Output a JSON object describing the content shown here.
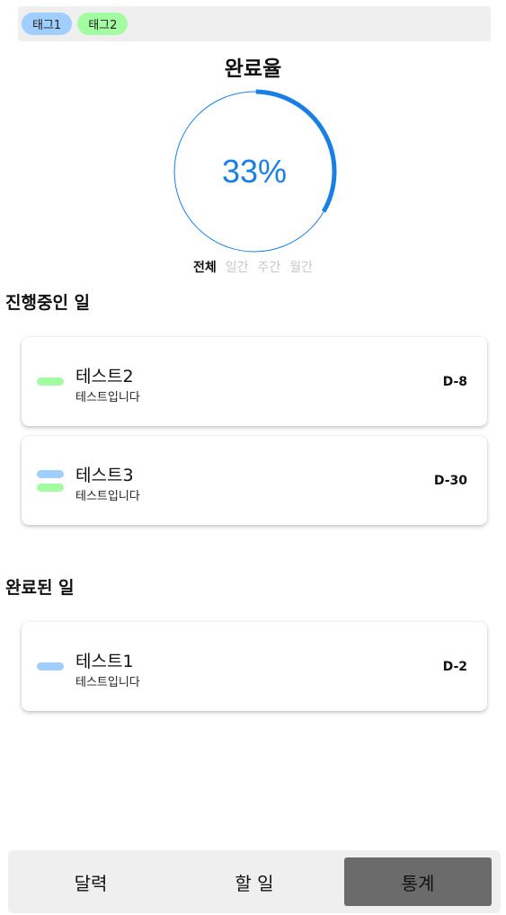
{
  "tags": [
    {
      "label": "태그1",
      "color": "#a0ceff"
    },
    {
      "label": "태그2",
      "color": "#a3fca0"
    }
  ],
  "completion": {
    "title": "완료율",
    "percent": 33,
    "percent_label": "33%",
    "arc_color": "#1a7fe5"
  },
  "periods": [
    {
      "label": "전체",
      "active": true
    },
    {
      "label": "일간",
      "active": false
    },
    {
      "label": "주간",
      "active": false
    },
    {
      "label": "월간",
      "active": false
    }
  ],
  "in_progress": {
    "title": "진행중인 일",
    "items": [
      {
        "title": "테스트2",
        "desc": "테스트입니다",
        "dday": "D-8",
        "tags": [
          "green"
        ]
      },
      {
        "title": "테스트3",
        "desc": "테스트입니다",
        "dday": "D-30",
        "tags": [
          "blue",
          "green"
        ]
      }
    ]
  },
  "completed": {
    "title": "완료된 일",
    "items": [
      {
        "title": "테스트1",
        "desc": "테스트입니다",
        "dday": "D-2",
        "tags": [
          "blue"
        ]
      }
    ]
  },
  "nav": [
    {
      "label": "달력",
      "active": false
    },
    {
      "label": "할 일",
      "active": false
    },
    {
      "label": "통계",
      "active": true
    }
  ]
}
